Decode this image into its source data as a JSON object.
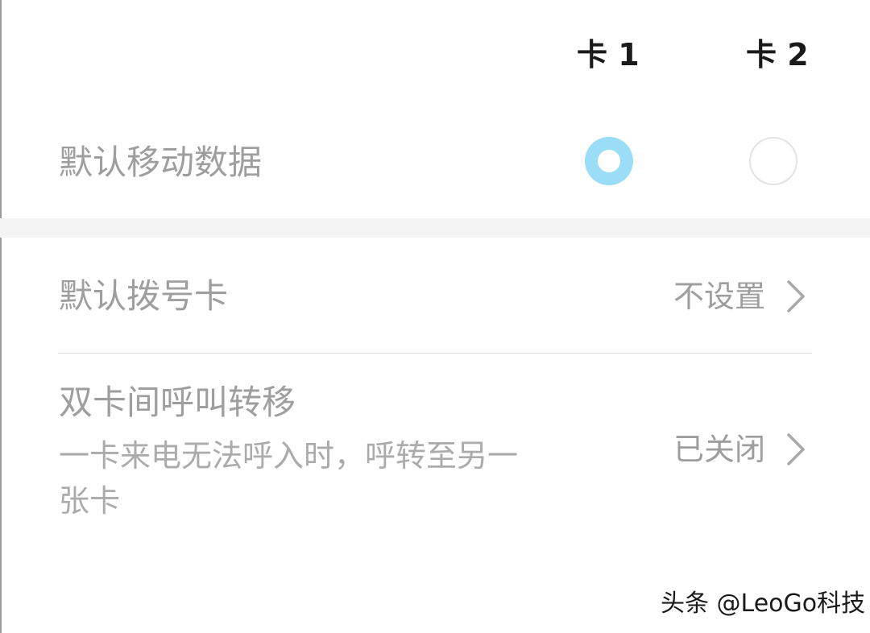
{
  "sim_headers": {
    "sim1": "卡 1",
    "sim2": "卡 2"
  },
  "default_data": {
    "label": "默认移动数据",
    "selected": "sim1"
  },
  "default_dial": {
    "label": "默认拨号卡",
    "value": "不设置",
    "icon": "chevron-right-icon"
  },
  "call_forwarding": {
    "title": "双卡间呼叫转移",
    "description": "一卡来电无法呼入时，呼转至另一张卡",
    "value": "已关闭",
    "icon": "chevron-right-icon"
  },
  "watermark": "头条 @LeoGo科技",
  "colors": {
    "radio_checked": "#9bdcf6",
    "radio_unchecked_border": "#e3e3e3",
    "label_text": "#9e9e9e",
    "header_text": "#1a1a1a",
    "section_band": "#f4f4f4"
  }
}
